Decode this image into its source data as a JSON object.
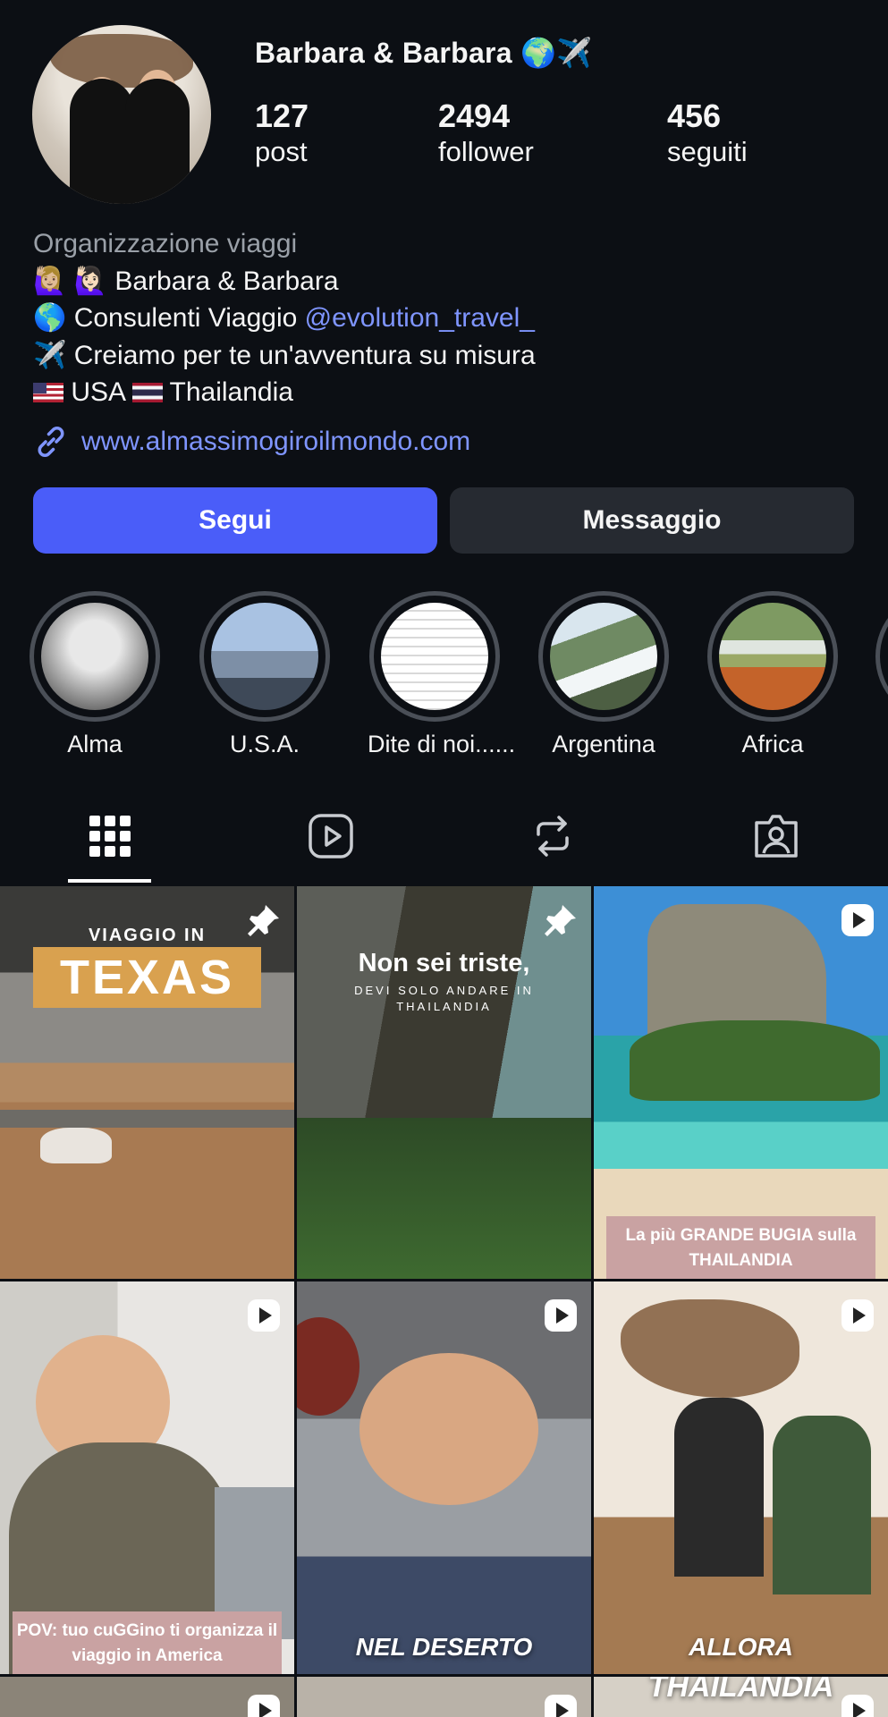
{
  "profile": {
    "name": "Barbara & Barbara 🌍✈️",
    "stats": {
      "posts_count": "127",
      "posts_label": "post",
      "followers_count": "2494",
      "followers_label": "follower",
      "following_count": "456",
      "following_label": "seguiti"
    },
    "bio": {
      "category": "Organizzazione viaggi",
      "line1": "🙋🏼‍♀️ 🙋🏻‍♀️ Barbara & Barbara",
      "line2_prefix": "🌎 Consulenti Viaggio ",
      "line2_mention": "@evolution_travel_",
      "line3": "✈️ Creiamo per te un'avventura su misura",
      "line4_a": "USA",
      "line4_b": "Thailandia"
    },
    "link": "www.almassimogiroilmondo.com"
  },
  "actions": {
    "follow_label": "Segui",
    "message_label": "Messaggio"
  },
  "highlights": [
    {
      "label": "Alma",
      "colors": [
        "#cfcfcf",
        "#555"
      ]
    },
    {
      "label": "U.S.A.",
      "colors": [
        "#9bb7d9",
        "#4f5e70"
      ]
    },
    {
      "label": "Dite di noi......",
      "colors": [
        "#ffffff",
        "#e9e9e9"
      ]
    },
    {
      "label": "Argentina",
      "colors": [
        "#7f8f7a",
        "#eef3f5"
      ]
    },
    {
      "label": "Africa",
      "colors": [
        "#88a56b",
        "#c2692e"
      ]
    }
  ],
  "tabs": [
    "grid-icon",
    "reels-icon",
    "reposts-icon",
    "tagged-icon"
  ],
  "posts": [
    {
      "top_text": "VIAGGIO IN",
      "banner_text": "TEXAS",
      "icon": "pin-icon"
    },
    {
      "top_text": "Non sei triste,",
      "sub_text": "DEVI SOLO ANDARE IN THAILANDIA",
      "icon": "pin-icon"
    },
    {
      "caption": "La più GRANDE BUGIA sulla THAILANDIA",
      "icon": "reel-icon"
    },
    {
      "caption": "POV: tuo cuGGino ti organizza il viaggio in America",
      "icon": "reel-icon"
    },
    {
      "caption": "NEL DESERTO",
      "icon": "reel-icon"
    },
    {
      "caption": "ALLORA",
      "caption2": "THAILANDIA",
      "icon": "reel-icon"
    }
  ]
}
